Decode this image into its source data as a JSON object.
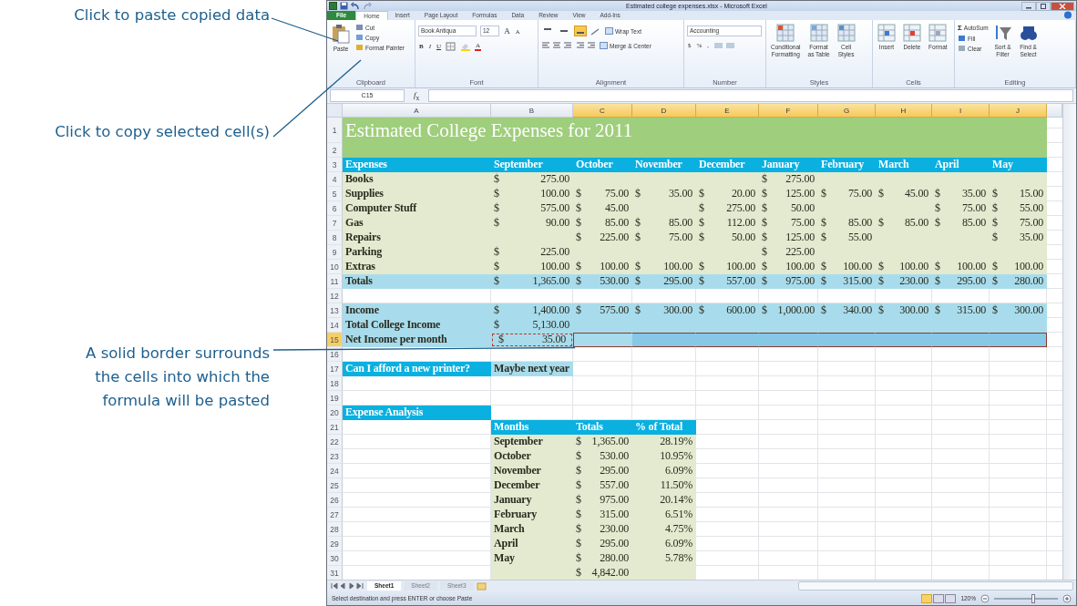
{
  "callouts": [
    {
      "text": "Click to paste copied data"
    },
    {
      "text": "Click to copy selected cell(s)"
    },
    {
      "text": "A solid border surrounds\nthe cells into which the\nformula will be pasted"
    }
  ],
  "window": {
    "title": "Estimated college expenses.xlsx - Microsoft Excel"
  },
  "tabs": [
    {
      "label": "File",
      "kind": "file",
      "selected": false
    },
    {
      "label": "Home",
      "kind": "tab",
      "selected": true
    },
    {
      "label": "Insert",
      "kind": "tab",
      "selected": false
    },
    {
      "label": "Page Layout",
      "kind": "tab",
      "selected": false
    },
    {
      "label": "Formulas",
      "kind": "tab",
      "selected": false
    },
    {
      "label": "Data",
      "kind": "tab",
      "selected": false
    },
    {
      "label": "Review",
      "kind": "tab",
      "selected": false
    },
    {
      "label": "View",
      "kind": "tab",
      "selected": false
    },
    {
      "label": "Add-Ins",
      "kind": "tab",
      "selected": false
    }
  ],
  "ribbon": {
    "clipboard": {
      "label": "Clipboard",
      "paste": "Paste",
      "items": [
        "Cut",
        "Copy",
        "Format Painter"
      ]
    },
    "font": {
      "label": "Font",
      "family": "Book Antiqua",
      "size": "12",
      "grow": "A",
      "shrink": "A",
      "styles": [
        "B",
        "I",
        "U"
      ],
      "color_button": "A"
    },
    "alignment": {
      "label": "Alignment",
      "vertical": [
        {
          "selected": false
        },
        {
          "selected": false
        },
        {
          "selected": true
        }
      ],
      "wrap": "Wrap Text",
      "merge": "Merge & Center"
    },
    "number": {
      "label": "Number",
      "format": "Accounting",
      "buttons": [
        "$",
        "%",
        ","
      ]
    },
    "styles": {
      "label": "Styles",
      "buttons": [
        "Conditional\nFormatting",
        "Format\nas Table",
        "Cell\nStyles"
      ]
    },
    "cells": {
      "label": "Cells",
      "buttons": [
        "Insert",
        "Delete",
        "Format"
      ]
    },
    "editing": {
      "label": "Editing",
      "sigma": "Σ",
      "items": [
        "AutoSum",
        "Fill",
        "Clear"
      ],
      "buttons": [
        "Sort &\nFilter",
        "Find &\nSelect"
      ]
    }
  },
  "formula_bar": {
    "name_box": "C15",
    "fx": "*f*$_{x}$"
  },
  "sheet": {
    "columns": [
      {
        "label": "A",
        "selected": false
      },
      {
        "label": "B",
        "selected": false
      },
      {
        "label": "C",
        "selected": true
      },
      {
        "label": "D",
        "selected": true
      },
      {
        "label": "E",
        "selected": true
      },
      {
        "label": "F",
        "selected": true
      },
      {
        "label": "G",
        "selected": true
      },
      {
        "label": "H",
        "selected": true
      },
      {
        "label": "I",
        "selected": true
      },
      {
        "label": "J",
        "selected": true
      }
    ],
    "rows": [
      {
        "num": "1",
        "selected": false,
        "kind": "title",
        "cells": [
          "Estimated College Expenses for 2011"
        ]
      },
      {
        "num": "2",
        "selected": false,
        "kind": "title",
        "cells": []
      },
      {
        "num": "3",
        "selected": false,
        "kind": "header",
        "cells": [
          {
            "t": "Expenses",
            "bold": true
          },
          "September",
          "October",
          "November",
          "December",
          "January",
          "February",
          "March",
          "April",
          "May"
        ]
      },
      {
        "num": "4",
        "selected": false,
        "kind": "data",
        "cells": [
          "Books",
          {
            "sym": "$",
            "amt": "275.00"
          },
          null,
          null,
          null,
          {
            "sym": "$",
            "amt": "275.00"
          }
        ]
      },
      {
        "num": "5",
        "selected": false,
        "kind": "data",
        "cells": [
          "Supplies",
          {
            "sym": "$",
            "amt": "100.00"
          },
          {
            "sym": "$",
            "amt": "75.00"
          },
          {
            "sym": "$",
            "amt": "35.00"
          },
          {
            "sym": "$",
            "amt": "20.00"
          },
          {
            "sym": "$",
            "amt": "125.00"
          },
          {
            "sym": "$",
            "amt": "75.00"
          },
          {
            "sym": "$",
            "amt": "45.00"
          },
          {
            "sym": "$",
            "amt": "35.00"
          },
          {
            "sym": "$",
            "amt": "15.00"
          }
        ]
      },
      {
        "num": "6",
        "selected": false,
        "kind": "data",
        "cells": [
          "Computer Stuff",
          {
            "sym": "$",
            "amt": "575.00"
          },
          {
            "sym": "$",
            "amt": "45.00"
          },
          null,
          {
            "sym": "$",
            "amt": "275.00"
          },
          {
            "sym": "$",
            "amt": "50.00"
          },
          null,
          null,
          {
            "sym": "$",
            "amt": "75.00"
          },
          {
            "sym": "$",
            "amt": "55.00"
          }
        ]
      },
      {
        "num": "7",
        "selected": false,
        "kind": "data",
        "cells": [
          "Gas",
          {
            "sym": "$",
            "amt": "90.00"
          },
          {
            "sym": "$",
            "amt": "85.00"
          },
          {
            "sym": "$",
            "amt": "85.00"
          },
          {
            "sym": "$",
            "amt": "112.00"
          },
          {
            "sym": "$",
            "amt": "75.00"
          },
          {
            "sym": "$",
            "amt": "85.00"
          },
          {
            "sym": "$",
            "amt": "85.00"
          },
          {
            "sym": "$",
            "amt": "85.00"
          },
          {
            "sym": "$",
            "amt": "75.00"
          }
        ]
      },
      {
        "num": "8",
        "selected": false,
        "kind": "data",
        "cells": [
          "Repairs",
          null,
          {
            "sym": "$",
            "amt": "225.00"
          },
          {
            "sym": "$",
            "amt": "75.00"
          },
          {
            "sym": "$",
            "amt": "50.00"
          },
          {
            "sym": "$",
            "amt": "125.00"
          },
          {
            "sym": "$",
            "amt": "55.00"
          },
          null,
          null,
          {
            "sym": "$",
            "amt": "35.00"
          }
        ]
      },
      {
        "num": "9",
        "selected": false,
        "kind": "data",
        "cells": [
          "Parking",
          {
            "sym": "$",
            "amt": "225.00"
          },
          null,
          null,
          null,
          {
            "sym": "$",
            "amt": "225.00"
          }
        ]
      },
      {
        "num": "10",
        "selected": false,
        "kind": "data",
        "cells": [
          "Extras",
          {
            "sym": "$",
            "amt": "100.00"
          },
          {
            "sym": "$",
            "amt": "100.00"
          },
          {
            "sym": "$",
            "amt": "100.00"
          },
          {
            "sym": "$",
            "amt": "100.00"
          },
          {
            "sym": "$",
            "amt": "100.00"
          },
          {
            "sym": "$",
            "amt": "100.00"
          },
          {
            "sym": "$",
            "amt": "100.00"
          },
          {
            "sym": "$",
            "amt": "100.00"
          },
          {
            "sym": "$",
            "amt": "100.00"
          }
        ]
      },
      {
        "num": "11",
        "selected": false,
        "kind": "total",
        "cells": [
          {
            "t": "Totals",
            "bold": true
          },
          {
            "sym": "$",
            "amt": "1,365.00"
          },
          {
            "sym": "$",
            "amt": "530.00"
          },
          {
            "sym": "$",
            "amt": "295.00"
          },
          {
            "sym": "$",
            "amt": "557.00"
          },
          {
            "sym": "$",
            "amt": "975.00"
          },
          {
            "sym": "$",
            "amt": "315.00"
          },
          {
            "sym": "$",
            "amt": "230.00"
          },
          {
            "sym": "$",
            "amt": "295.00"
          },
          {
            "sym": "$",
            "amt": "280.00"
          }
        ]
      },
      {
        "num": "12",
        "selected": false,
        "kind": "blank",
        "cells": []
      },
      {
        "num": "13",
        "selected": false,
        "kind": "total",
        "cells": [
          "Income",
          {
            "sym": "$",
            "amt": "1,400.00"
          },
          {
            "sym": "$",
            "amt": "575.00"
          },
          {
            "sym": "$",
            "amt": "300.00"
          },
          {
            "sym": "$",
            "amt": "600.00"
          },
          {
            "sym": "$",
            "amt": "1,000.00"
          },
          {
            "sym": "$",
            "amt": "340.00"
          },
          {
            "sym": "$",
            "amt": "300.00"
          },
          {
            "sym": "$",
            "amt": "315.00"
          },
          {
            "sym": "$",
            "amt": "300.00"
          }
        ]
      },
      {
        "num": "14",
        "selected": false,
        "kind": "total",
        "cells": [
          "Total College Income",
          {
            "sym": "$",
            "amt": "5,130.00"
          }
        ]
      },
      {
        "num": "15",
        "selected": true,
        "kind": "total",
        "cells": [
          "Net Income per month",
          {
            "sym": "$",
            "amt": "35.00",
            "copied": true
          },
          {
            "paste": true
          },
          {
            "paste": true
          },
          {
            "paste": true
          },
          {
            "paste": true
          },
          {
            "paste": true
          },
          {
            "paste": true
          },
          {
            "paste": true
          },
          {
            "paste": true
          }
        ]
      },
      {
        "num": "16",
        "selected": false,
        "kind": "blank",
        "cells": []
      },
      {
        "num": "17",
        "selected": false,
        "kind": "question",
        "cells": [
          "Can I afford a new printer?",
          "Maybe next year"
        ]
      },
      {
        "num": "18",
        "selected": false,
        "kind": "blank",
        "cells": []
      },
      {
        "num": "19",
        "selected": false,
        "kind": "blank",
        "cells": []
      },
      {
        "num": "20",
        "selected": false,
        "kind": "section",
        "cells": [
          "Expense Analysis"
        ]
      },
      {
        "num": "21",
        "selected": false,
        "kind": "analysis_head",
        "cells": [
          null,
          "Months",
          "Totals",
          "% of Total"
        ]
      },
      {
        "num": "22",
        "selected": false,
        "kind": "analysis",
        "cells": [
          null,
          "September",
          {
            "sym": "$",
            "amt": "1,365.00"
          },
          {
            "num": "28.19%"
          }
        ]
      },
      {
        "num": "23",
        "selected": false,
        "kind": "analysis",
        "cells": [
          null,
          "October",
          {
            "sym": "$",
            "amt": "530.00"
          },
          {
            "num": "10.95%"
          }
        ]
      },
      {
        "num": "24",
        "selected": false,
        "kind": "analysis",
        "cells": [
          null,
          "November",
          {
            "sym": "$",
            "amt": "295.00"
          },
          {
            "num": "6.09%"
          }
        ]
      },
      {
        "num": "25",
        "selected": false,
        "kind": "analysis",
        "cells": [
          null,
          "December",
          {
            "sym": "$",
            "amt": "557.00"
          },
          {
            "num": "11.50%"
          }
        ]
      },
      {
        "num": "26",
        "selected": false,
        "kind": "analysis",
        "cells": [
          null,
          "January",
          {
            "sym": "$",
            "amt": "975.00"
          },
          {
            "num": "20.14%"
          }
        ]
      },
      {
        "num": "27",
        "selected": false,
        "kind": "analysis",
        "cells": [
          null,
          "February",
          {
            "sym": "$",
            "amt": "315.00"
          },
          {
            "num": "6.51%"
          }
        ]
      },
      {
        "num": "28",
        "selected": false,
        "kind": "analysis",
        "cells": [
          null,
          "March",
          {
            "sym": "$",
            "amt": "230.00"
          },
          {
            "num": "4.75%"
          }
        ]
      },
      {
        "num": "29",
        "selected": false,
        "kind": "analysis",
        "cells": [
          null,
          "April",
          {
            "sym": "$",
            "amt": "295.00"
          },
          {
            "num": "6.09%"
          }
        ]
      },
      {
        "num": "30",
        "selected": false,
        "kind": "analysis",
        "cells": [
          null,
          "May",
          {
            "sym": "$",
            "amt": "280.00"
          },
          {
            "num": "5.78%"
          }
        ]
      },
      {
        "num": "31",
        "selected": false,
        "kind": "analysis",
        "cells": [
          null,
          null,
          {
            "sym": "$",
            "amt": "4,842.00"
          }
        ]
      }
    ]
  },
  "sheet_tabs": [
    {
      "label": "Sheet1",
      "selected": true
    },
    {
      "label": "Sheet2",
      "selected": false
    },
    {
      "label": "Sheet3",
      "selected": false
    }
  ],
  "status_bar": {
    "message": "Select destination and press ENTER or choose Paste",
    "zoom": "120%",
    "zoom_slider": {
      "level": 0.62
    }
  }
}
